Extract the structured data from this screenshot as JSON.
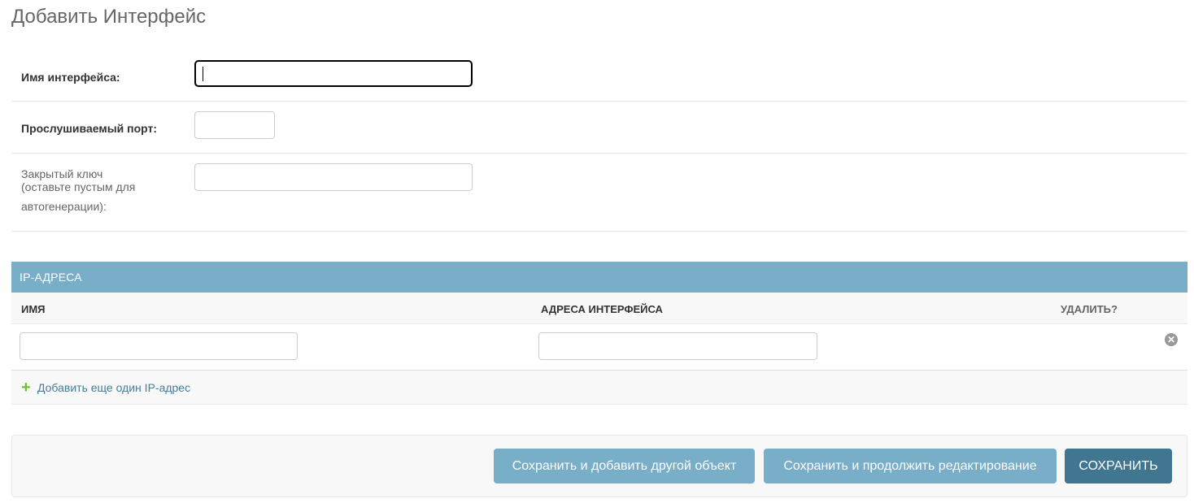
{
  "page": {
    "title": "Добавить Интерфейс"
  },
  "form": {
    "interface_name_label": "Имя интерфейса:",
    "interface_name_value": "",
    "listen_port_label": "Прослушиваемый порт:",
    "listen_port_value": "",
    "private_key_label_line1": "Закрытый ключ",
    "private_key_label_line2": "(оставьте пустым для",
    "private_key_label_line3": "автогенерации):",
    "private_key_value": ""
  },
  "inline": {
    "title": "IP-АДРЕСА",
    "columns": [
      "Имя",
      "Адреса интерфейса",
      "Удалить?"
    ],
    "rows": [
      {
        "name": "",
        "address": ""
      }
    ],
    "add_link": "Добавить еще один IP-адрес",
    "delete_icon": "close-circle-icon",
    "add_icon": "plus-icon"
  },
  "actions": {
    "save_add_another": "Сохранить и добавить другой объект",
    "save_continue": "Сохранить и продолжить редактирование",
    "save": "Сохранить"
  },
  "colors": {
    "header": "#79aec8",
    "primary_button": "#417690",
    "secondary_button": "#79aec8",
    "add_icon": "#70bf2b"
  }
}
